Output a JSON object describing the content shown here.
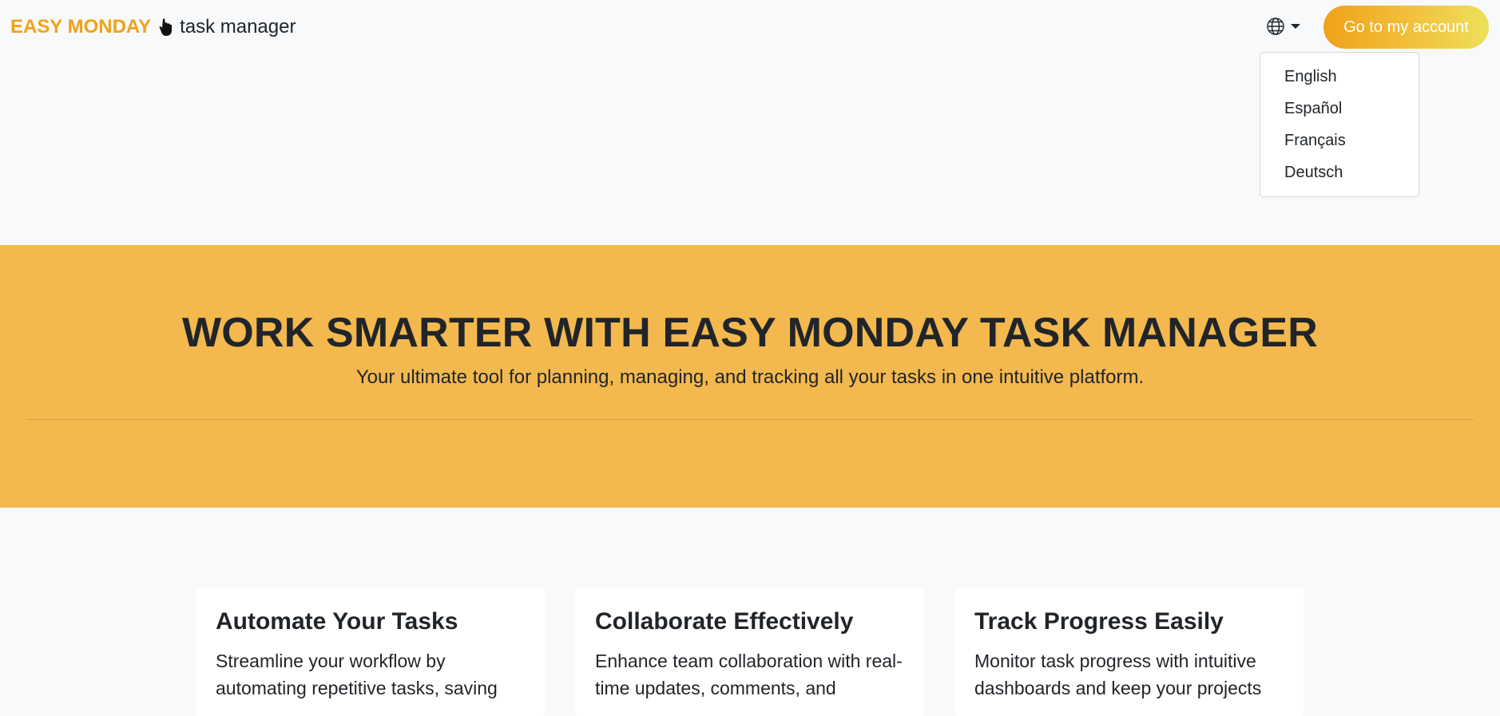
{
  "header": {
    "brand_name": "EASY MONDAY",
    "brand_icon": "hand-pointer-icon",
    "brand_subtitle": "task manager",
    "language_icon": "globe-icon",
    "account_button": "Go to my account"
  },
  "language_menu": {
    "items": [
      "English",
      "Español",
      "Français",
      "Deutsch"
    ]
  },
  "hero": {
    "title": "WORK SMARTER WITH EASY MONDAY TASK MANAGER",
    "subtitle": "Your ultimate tool for planning, managing, and tracking all your tasks in one intuitive platform."
  },
  "features": [
    {
      "title": "Automate Your Tasks",
      "text": "Streamline your workflow by automating repetitive tasks, saving"
    },
    {
      "title": "Collaborate Effectively",
      "text": "Enhance team collaboration with real-time updates, comments, and"
    },
    {
      "title": "Track Progress Easily",
      "text": "Monitor task progress with intuitive dashboards and keep your projects"
    }
  ],
  "colors": {
    "brand_orange": "#f0a11a",
    "hero_background": "#f3b84e",
    "page_background": "#f8f9fa",
    "text_dark": "#212529"
  }
}
